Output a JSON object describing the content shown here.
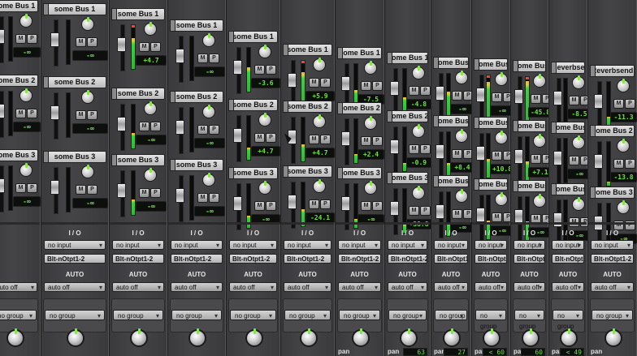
{
  "app": "Mixer",
  "colors": {
    "meter_green": "#35d63a",
    "meter_peak": "#e84a2a",
    "readout_green": "#6de33a",
    "knob_indicator": "#7cf02a"
  },
  "strips": [
    {
      "sends": [
        {
          "bus": "some Bus 1",
          "value": "-∞"
        },
        {
          "bus": "some Bus 2",
          "value": "-∞"
        },
        {
          "bus": "some Bus 3",
          "value": "-∞"
        }
      ],
      "io_header": "",
      "input": "",
      "output": "",
      "auto_header": "",
      "auto": "auto off",
      "group": "no group",
      "pan_label": "",
      "pan_value": ""
    },
    {
      "sends": [
        {
          "bus": "some Bus 1",
          "value": "-∞"
        },
        {
          "bus": "some Bus 2",
          "value": "-∞"
        },
        {
          "bus": "some Bus 3",
          "value": "-∞"
        }
      ],
      "io_header": "I / O",
      "input": "no input",
      "output": "Blt-nOtpt1-2",
      "auto_header": "AUTO",
      "auto": "auto off",
      "group": "no group",
      "pan_label": "",
      "pan_value": ""
    },
    {
      "sends": [
        {
          "bus": "some Bus 1",
          "value": "+4.7"
        },
        {
          "bus": "some Bus 2",
          "value": "-∞"
        },
        {
          "bus": "some Bus 3",
          "value": "-∞"
        }
      ],
      "io_header": "I / O",
      "input": "no input",
      "output": "Blt-nOtpt1-2",
      "auto_header": "AUTO",
      "auto": "auto off",
      "group": "no group",
      "pan_label": "",
      "pan_value": ""
    },
    {
      "sends": [
        {
          "bus": "some Bus 1",
          "value": "-∞"
        },
        {
          "bus": "some Bus 2",
          "value": "-∞"
        },
        {
          "bus": "some Bus 3",
          "value": "-∞"
        }
      ],
      "io_header": "I / O",
      "input": "no input",
      "output": "Blt-nOtpt1-2",
      "auto_header": "AUTO",
      "auto": "auto off",
      "group": "no group",
      "pan_label": "",
      "pan_value": ""
    },
    {
      "sends": [
        {
          "bus": "some Bus 1",
          "value": "-3.6"
        },
        {
          "bus": "some Bus 2",
          "value": "+4.7"
        },
        {
          "bus": "some Bus 3",
          "value": "-∞"
        }
      ],
      "io_header": "I / O",
      "input": "no input",
      "output": "Blt-nOtpt1-2",
      "auto_header": "AUTO",
      "auto": "auto off",
      "group": "no group",
      "pan_label": "",
      "pan_value": ""
    },
    {
      "sends": [
        {
          "bus": "some Bus 1",
          "value": "+5.9"
        },
        {
          "bus": "some Bus 2",
          "value": "+4.7"
        },
        {
          "bus": "some Bus 3",
          "value": "-24.1"
        }
      ],
      "io_header": "I / O",
      "input": "no input",
      "output": "Blt-nOtpt1-2",
      "auto_header": "AUTO",
      "auto": "auto off",
      "group": "no group",
      "pan_label": "",
      "pan_value": ""
    },
    {
      "sends": [
        {
          "bus": "some Bus 1",
          "value": "-7.5"
        },
        {
          "bus": "some Bus 2",
          "value": "+2.4"
        },
        {
          "bus": "some Bus 3",
          "value": "-∞"
        }
      ],
      "io_header": "I / O",
      "input": "no input",
      "output": "Blt-nOtpt1-2",
      "auto_header": "AUTO",
      "auto": "auto off",
      "group": "no group",
      "pan_label": "pan",
      "pan_value": ""
    },
    {
      "sends": [
        {
          "bus": "some Bus 1",
          "value": "-4.8"
        },
        {
          "bus": "some Bus 2",
          "value": "-0.9"
        },
        {
          "bus": "some Bus 3",
          "value": "-38.8"
        }
      ],
      "io_header": "I / O",
      "input": "no input",
      "output": "Blt-nOtpt1-2",
      "auto_header": "AUTO",
      "auto": "auto off",
      "group": "no group",
      "pan_label": "pan",
      "pan_value": "63"
    },
    {
      "sends": [
        {
          "bus": "some Bus 1",
          "value": "-∞"
        },
        {
          "bus": "some Bus 2",
          "value": "+8.4"
        },
        {
          "bus": "some Bus 3",
          "value": "-∞"
        }
      ],
      "io_header": "I / O",
      "input": "no input",
      "output": "Blt-nOtpt1-2",
      "auto_header": "AUTO",
      "auto": "auto off",
      "group": "no group",
      "pan_label": "pan",
      "pan_value": "27"
    },
    {
      "sends": [
        {
          "bus": "some Bus 1",
          "value": "-∞"
        },
        {
          "bus": "some Bus 2",
          "value": "+10.8"
        },
        {
          "bus": "some Bus 3",
          "value": "-∞"
        }
      ],
      "io_header": "I / O",
      "input": "no input",
      "output": "Blt-nOtpt1-2",
      "auto_header": "AUTO",
      "auto": "auto off",
      "group": "no group",
      "pan_label": "pan",
      "pan_value": "< 60"
    },
    {
      "sends": [
        {
          "bus": "some Bus 1",
          "value": "-45.8"
        },
        {
          "bus": "some Bus 2",
          "value": "+7.1"
        },
        {
          "bus": "some Bus 3",
          "value": "-∞"
        }
      ],
      "io_header": "I / O",
      "input": "no input",
      "output": "Blt-nOtpt1-2",
      "auto_header": "AUTO",
      "auto": "auto off",
      "group": "no group",
      "pan_label": "pan",
      "pan_value": "60"
    },
    {
      "sends": [
        {
          "bus": "Reverbsend",
          "value": "-8.5"
        },
        {
          "bus": "some Bus 2",
          "value": "-∞"
        },
        {
          "bus": "some Bus 3",
          "value": "-∞"
        }
      ],
      "io_header": "I / O",
      "input": "no input",
      "output": "Blt-nOtpt1-2",
      "auto_header": "AUTO",
      "auto": "auto off",
      "group": "no group",
      "pan_label": "pan",
      "pan_value": "< 49"
    },
    {
      "sends": [
        {
          "bus": "Reverbsend",
          "value": "-11.3"
        },
        {
          "bus": "some Bus 2",
          "value": "-13.8"
        },
        {
          "bus": "some Bus 3",
          "value": "-∞"
        }
      ],
      "io_header": "I / O",
      "input": "no input",
      "output": "Blt-nOtpt1-2",
      "auto_header": "AUTO",
      "auto": "auto off",
      "group": "no group",
      "pan_label": "pan",
      "pan_value": ""
    }
  ]
}
